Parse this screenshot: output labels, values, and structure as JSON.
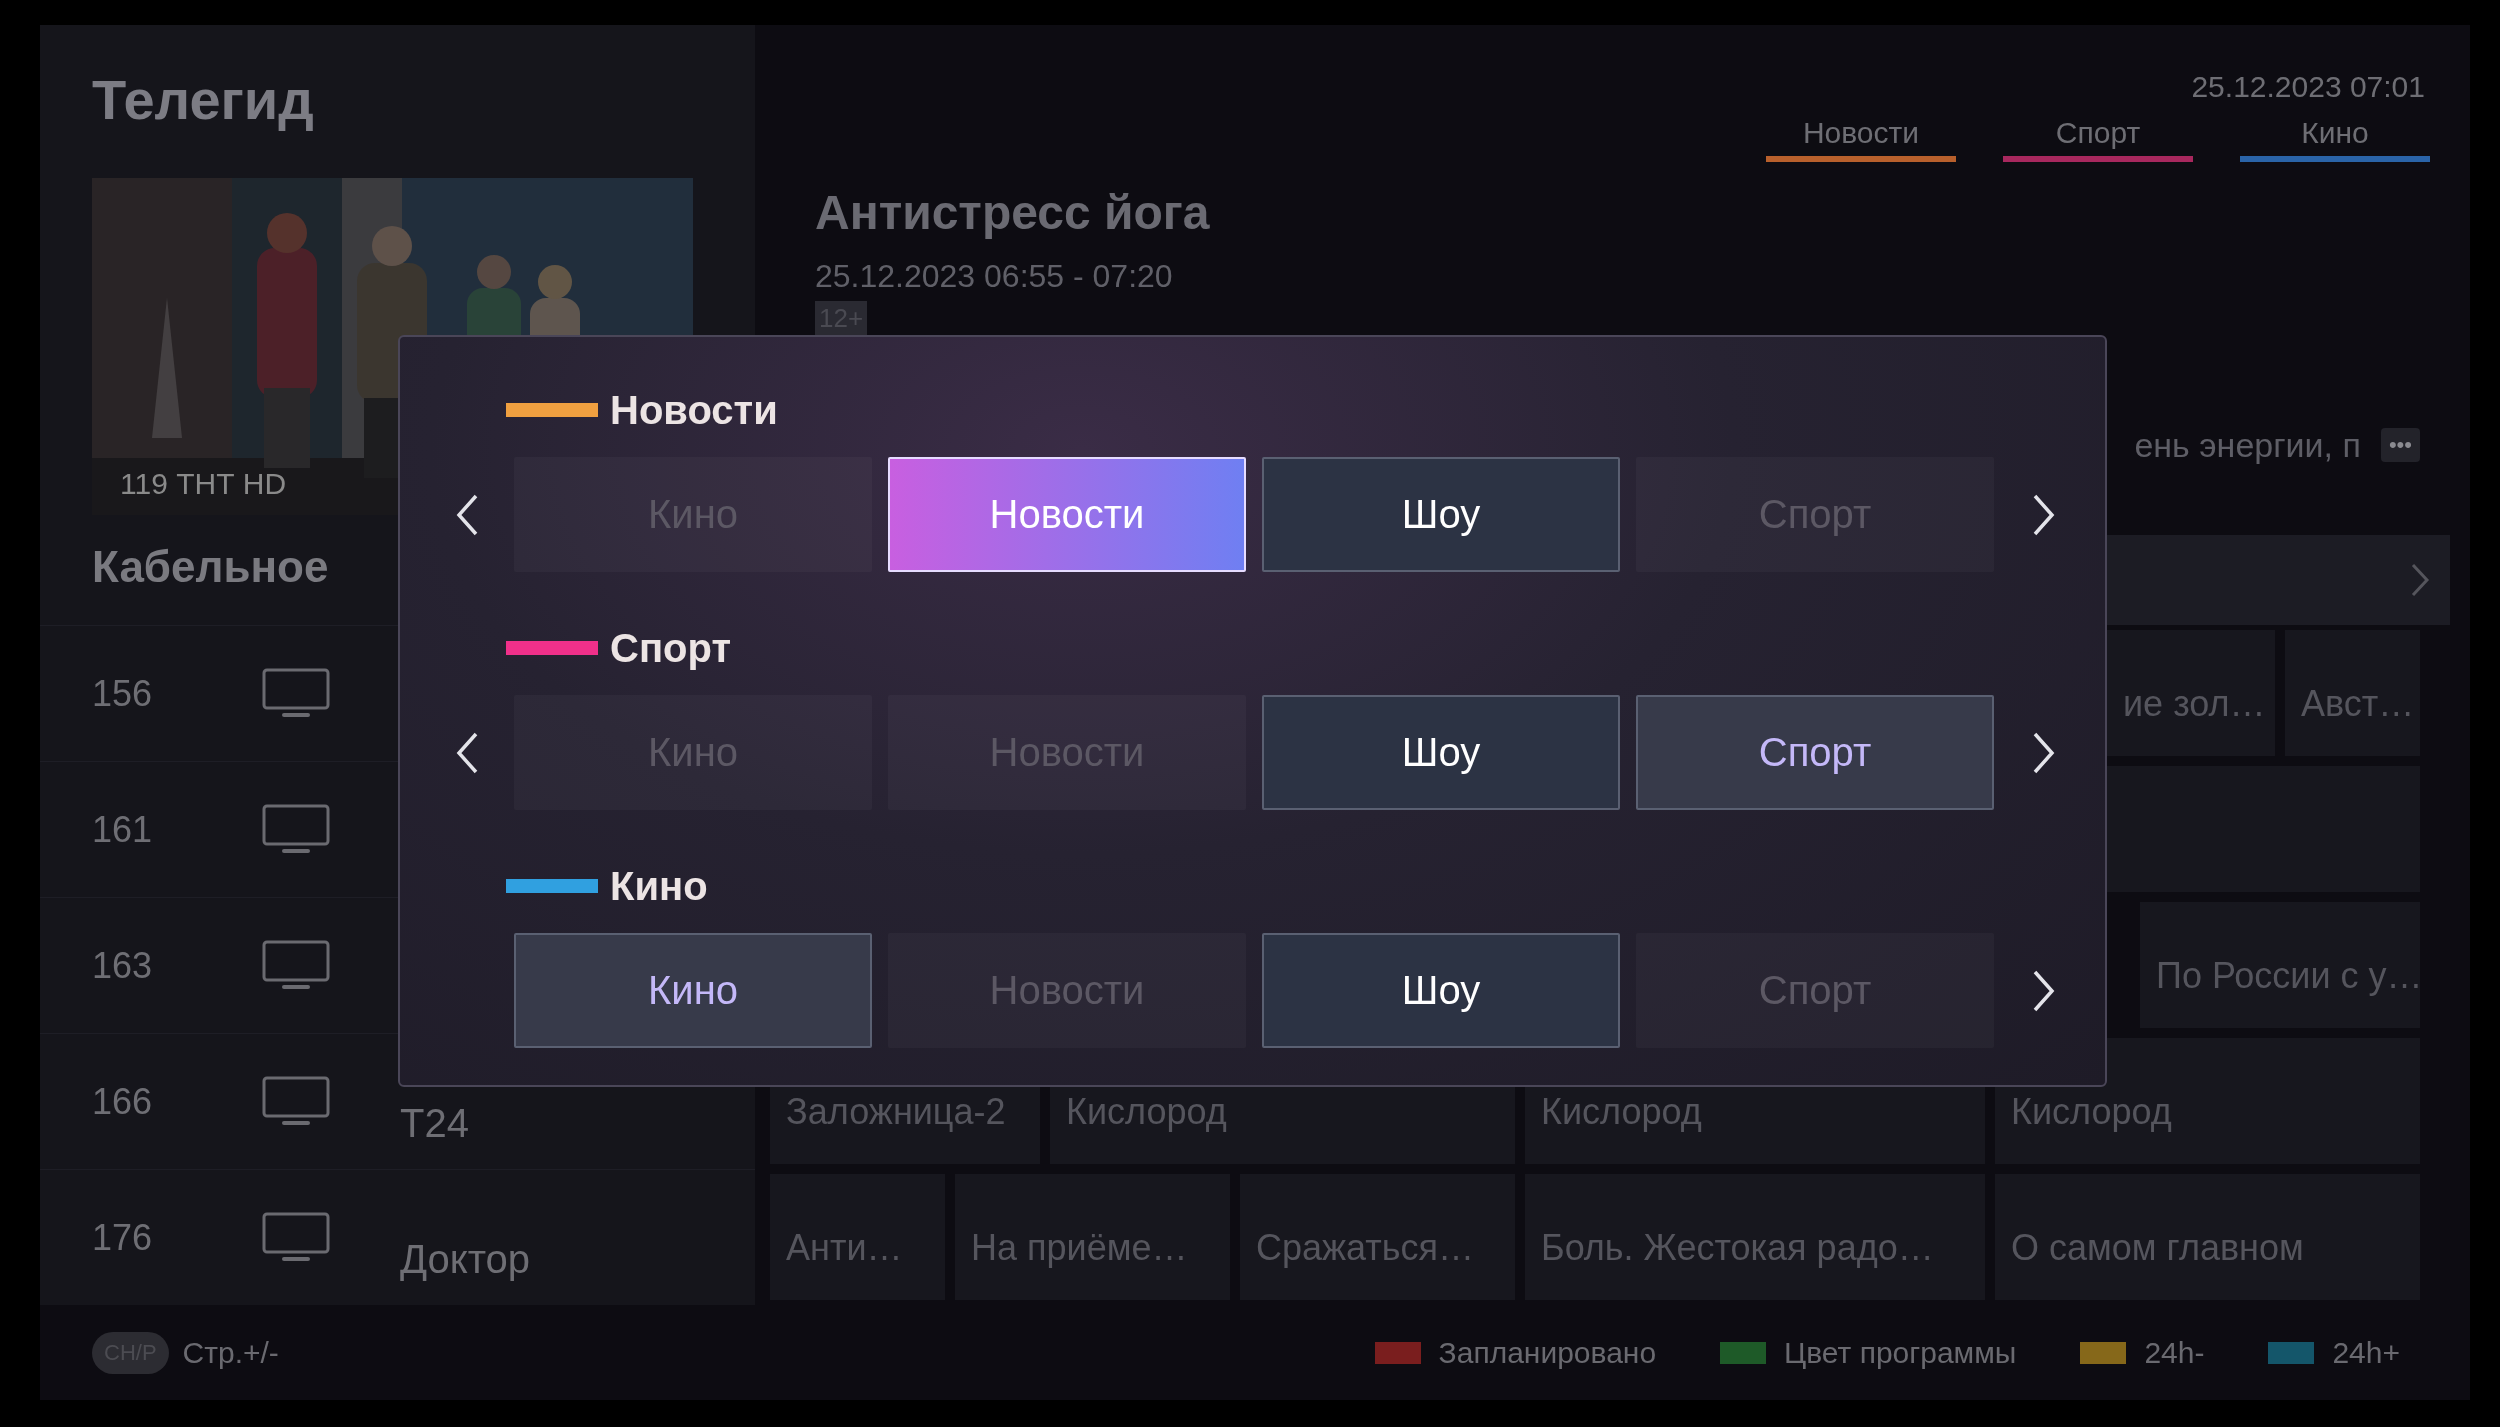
{
  "sidebar": {
    "title": "Телегид",
    "preview": {
      "kind": "picture",
      "caption": "119 ТНТ HD"
    },
    "group": "Кабельное"
  },
  "channels": [
    {
      "number": "156",
      "programs": [
        "ие зол…",
        "Авст…"
      ]
    },
    {
      "number": "161"
    },
    {
      "number": "163",
      "programs": [
        "По России с у…"
      ]
    },
    {
      "number": "166",
      "name": "Т24",
      "programs": [
        "Заложница-2",
        "Кислород",
        "Кислород",
        "Кислород"
      ]
    },
    {
      "number": "176",
      "name": "Доктор",
      "programs": [
        "Анти…",
        "На приёме…",
        "Сражаться…",
        "Боль. Жестокая радо…",
        "О самом главном"
      ]
    }
  ],
  "clock": "25.12.2023 07:01",
  "filter_tabs": [
    {
      "label": "Новости",
      "color": "#b8602c"
    },
    {
      "label": "Спорт",
      "color": "#a8285e"
    },
    {
      "label": "Кино",
      "color": "#2a64a8"
    }
  ],
  "program": {
    "title": "Антистресс йога",
    "time": "25.12.2023 06:55 - 07:20",
    "rating": "12+",
    "description": "ень энергии, п",
    "more_button": "•••"
  },
  "dialog": {
    "sections": [
      {
        "label": "Новости",
        "color": "#f0a040",
        "has_prev": true,
        "has_next": true,
        "options": [
          {
            "label": "Кино",
            "selected": false,
            "focused": false,
            "highlighted": false
          },
          {
            "label": "Новости",
            "selected": true,
            "focused": true,
            "highlighted": false
          },
          {
            "label": "Шоу",
            "selected": true,
            "focused": false,
            "highlighted": false
          },
          {
            "label": "Спорт",
            "selected": false,
            "focused": false,
            "highlighted": false
          }
        ]
      },
      {
        "label": "Спорт",
        "color": "#f0308a",
        "has_prev": true,
        "has_next": true,
        "options": [
          {
            "label": "Кино",
            "selected": false,
            "focused": false,
            "highlighted": false
          },
          {
            "label": "Новости",
            "selected": false,
            "focused": false,
            "highlighted": false
          },
          {
            "label": "Шоу",
            "selected": true,
            "focused": false,
            "highlighted": false
          },
          {
            "label": "Спорт",
            "selected": true,
            "focused": false,
            "highlighted": true
          }
        ]
      },
      {
        "label": "Кино",
        "color": "#30a0e0",
        "has_prev": false,
        "has_next": true,
        "options": [
          {
            "label": "Кино",
            "selected": true,
            "focused": false,
            "highlighted": true
          },
          {
            "label": "Новости",
            "selected": false,
            "focused": false,
            "highlighted": false
          },
          {
            "label": "Шоу",
            "selected": true,
            "focused": false,
            "highlighted": false
          },
          {
            "label": "Спорт",
            "selected": false,
            "focused": false,
            "highlighted": false
          }
        ]
      }
    ]
  },
  "footer": {
    "key": "CH/P",
    "hint": "Стр.+/-",
    "legend": [
      {
        "label": "Запланировано",
        "color": "#7a1e1e"
      },
      {
        "label": "Цвет программы",
        "color": "#1e5a28"
      },
      {
        "label": "24h-",
        "color": "#86681a"
      },
      {
        "label": "24h+",
        "color": "#14566a"
      }
    ]
  }
}
